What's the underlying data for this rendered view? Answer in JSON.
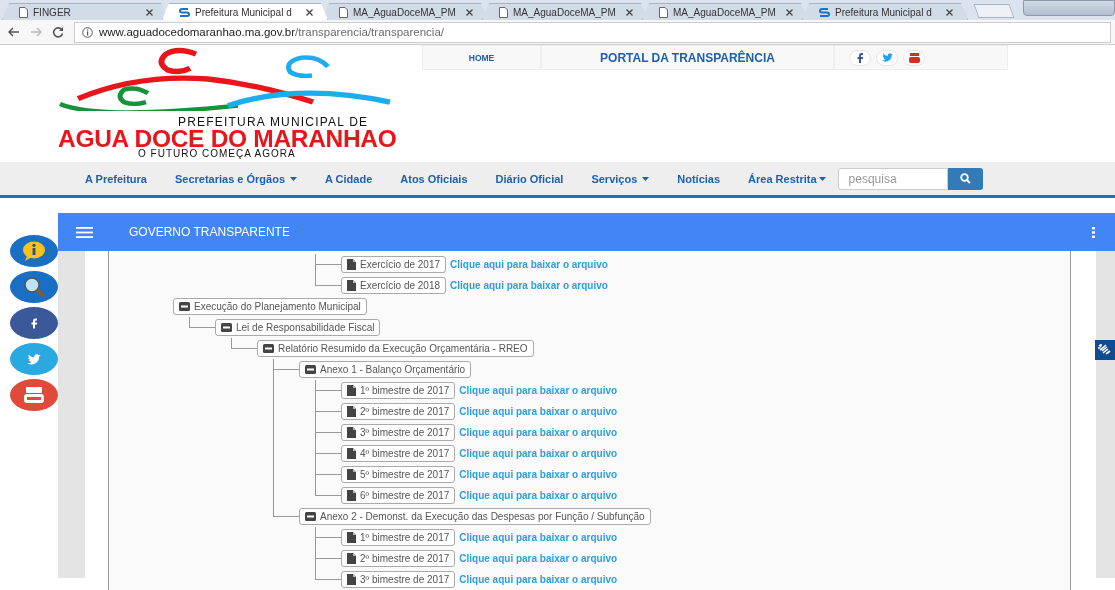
{
  "browser": {
    "tabs": [
      {
        "kind": "page",
        "title": "FINGER",
        "selected": false
      },
      {
        "kind": "site",
        "title": "Prefeitura Municipal d",
        "selected": true
      },
      {
        "kind": "page",
        "title": "MA_AguaDoceMA_PM",
        "selected": false
      },
      {
        "kind": "page",
        "title": "MA_AguaDoceMA_PM",
        "selected": false
      },
      {
        "kind": "page",
        "title": "MA_AguaDoceMA_PM",
        "selected": false
      },
      {
        "kind": "site",
        "title": "Prefeitura Municipal d",
        "selected": false
      }
    ],
    "url_host": "www.aguadocedomaranhao.ma.gov.br",
    "url_path": "/transparencia/transparencia/"
  },
  "logo": {
    "line1": "PREFEITURA MUNICIPAL DE",
    "line2": "AGUA DOCE DO MARANHAO",
    "line3": "O FUTURO COMEÇA AGORA"
  },
  "top_links": {
    "home": "HOME",
    "portal": "PORTAL DA TRANSPARÊNCIA"
  },
  "nav": [
    {
      "label": "A Prefeitura",
      "dropdown": false
    },
    {
      "label": "Secretarias e Órgãos",
      "dropdown": true
    },
    {
      "label": "A Cidade",
      "dropdown": false
    },
    {
      "label": "Atos Oficiais",
      "dropdown": false
    },
    {
      "label": "Diário Oficial",
      "dropdown": false
    },
    {
      "label": "Serviços",
      "dropdown": true
    },
    {
      "label": "Notícias",
      "dropdown": false
    },
    {
      "label": "Área Restrita",
      "dropdown": true
    }
  ],
  "search": {
    "placeholder": "pesquisa"
  },
  "panel": {
    "title": "GOVERNO TRANSPARENTE"
  },
  "tree": {
    "continued": [
      {
        "kind": "file",
        "label": "Exercício de 2017",
        "link": "Clique aqui para baixar o arquivo"
      },
      {
        "kind": "file",
        "label": "Exercício de 2018",
        "link": "Clique aqui para baixar o arquivo"
      }
    ],
    "nodes": [
      {
        "kind": "folder",
        "label": "Execução do Planejamento Municipal",
        "expanded": true,
        "children": [
          {
            "kind": "folder",
            "label": "Lei de Responsabilidade Fiscal",
            "expanded": true,
            "children": [
              {
                "kind": "folder",
                "label": "Relatório Resumido da Execução Orçamentária - RREO",
                "expanded": true,
                "children": [
                  {
                    "kind": "folder",
                    "label": "Anexo 1 - Balanço Orçamentário",
                    "expanded": true,
                    "children": [
                      {
                        "kind": "file",
                        "label": "1º bimestre de 2017",
                        "link": "Clique aqui para baixar o arquivo"
                      },
                      {
                        "kind": "file",
                        "label": "2º bimestre de 2017",
                        "link": "Clique aqui para baixar o arquivo"
                      },
                      {
                        "kind": "file",
                        "label": "3º bimestre de 2017",
                        "link": "Clique aqui para baixar o arquivo"
                      },
                      {
                        "kind": "file",
                        "label": "4º bimestre de 2017",
                        "link": "Clique aqui para baixar o arquivo"
                      },
                      {
                        "kind": "file",
                        "label": "5º bimestre de 2017",
                        "link": "Clique aqui para baixar o arquivo"
                      },
                      {
                        "kind": "file",
                        "label": "6º bimestre de 2017",
                        "link": "Clique aqui para baixar o arquivo"
                      }
                    ]
                  },
                  {
                    "kind": "folder",
                    "label": "Anexo 2 - Demonst. da Execução das Despesas por Função / Subfunção",
                    "expanded": true,
                    "children": [
                      {
                        "kind": "file",
                        "label": "1º bimestre de 2017",
                        "link": "Clique aqui para baixar o arquivo"
                      },
                      {
                        "kind": "file",
                        "label": "2º bimestre de 2017",
                        "link": "Clique aqui para baixar o arquivo"
                      },
                      {
                        "kind": "file",
                        "label": "3º bimestre de 2017",
                        "link": "Clique aqui para baixar o arquivo"
                      }
                    ]
                  }
                ]
              }
            ]
          }
        ]
      }
    ]
  }
}
